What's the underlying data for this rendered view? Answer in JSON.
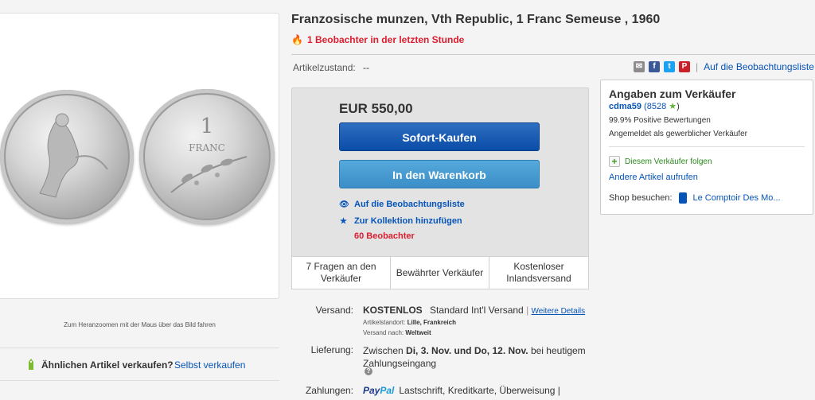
{
  "listing": {
    "title": "Franzosische munzen, Vth Republic, 1 Franc Semeuse , 1960",
    "hot_watchers": "1 Beobachter in der letzten Stunde",
    "condition_label": "Artikelzustand:",
    "condition_value": "--",
    "watchlist_link": "Auf die Beobachtungsliste"
  },
  "gallery": {
    "zoom_hint": "Zum Heranzoomen mit der Maus über das Bild fahren",
    "sell_question": "Ähnlichen Artikel verkaufen?",
    "sell_link": "Selbst verkaufen"
  },
  "buybox": {
    "price": "EUR 550,00",
    "buy_now": "Sofort-Kaufen",
    "add_to_cart": "In den Warenkorb",
    "add_watchlist": "Auf die Beobachtungsliste",
    "add_collection": "Zur Kollektion hinzufügen",
    "watchers": "60 Beobachter",
    "features": [
      "7 Fragen an den Verkäufer",
      "Bewährter Verkäufer",
      "Kostenloser Inlandsversand"
    ]
  },
  "seller": {
    "heading": "Angaben zum Verkäufer",
    "name": "cdma59",
    "feedback": "(8528",
    "feedback_close": ")",
    "positive": "99.9% Positive Bewertungen",
    "business": "Angemeldet als gewerblicher Verkäufer",
    "follow": "Diesem Verkäufer folgen",
    "other_items": "Andere Artikel aufrufen",
    "shop_label": "Shop besuchen:",
    "shop_name": "Le Comptoir Des Mo..."
  },
  "shipping": {
    "label": "Versand:",
    "cost": "KOSTENLOS",
    "method": "Standard Int'l Versand",
    "details_link": "Weitere Details",
    "location_label": "Artikelstandort:",
    "location": "Lille, Frankreich",
    "ship_to_label": "Versand nach:",
    "ship_to": "Weltweit"
  },
  "delivery": {
    "label": "Lieferung:",
    "prefix": "Zwischen",
    "range": "Di, 3. Nov. und Do, 12. Nov.",
    "suffix": "bei heutigem Zahlungseingang"
  },
  "payment": {
    "label": "Zahlungen:",
    "paypal_a": "Pay",
    "paypal_b": "Pal",
    "methods": "Lastschrift,  Kreditkarte,  Überweisung  |"
  },
  "colors": {
    "primary_button": "#0a4da8",
    "secondary_button": "#3b8ec7",
    "alert_red": "#dd1e31",
    "link_blue": "#0654ba"
  },
  "icons": [
    "flame-icon",
    "email-icon",
    "facebook-icon",
    "twitter-icon",
    "pinterest-icon",
    "eye-icon",
    "star-icon",
    "plus-icon",
    "shop-icon",
    "sell-tag-icon",
    "help-icon"
  ]
}
